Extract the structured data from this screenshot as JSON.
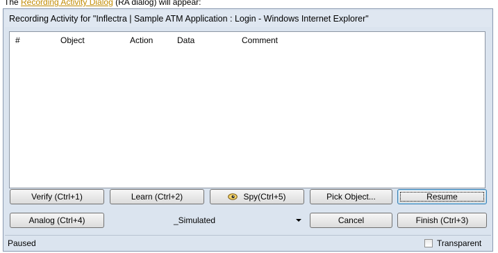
{
  "doc_text": {
    "prefix": "The ",
    "link": "Recording Activity Dialog",
    "suffix": " (RA dialog) will appear:"
  },
  "dialog": {
    "title": "Recording Activity for \"Inflectra | Sample ATM Application : Login - Windows Internet Explorer\""
  },
  "list": {
    "columns": [
      "#",
      "Object",
      "Action",
      "Data",
      "Comment"
    ]
  },
  "buttons": {
    "verify": "Verify (Ctrl+1)",
    "learn": "Learn (Ctrl+2)",
    "spy": "Spy(Ctrl+5)",
    "pick_object": "Pick Object...",
    "resume": "Resume",
    "analog": "Analog (Ctrl+4)",
    "cancel": "Cancel",
    "finish": "Finish (Ctrl+3)"
  },
  "play_mode": {
    "selected": "_Simulated"
  },
  "status": {
    "text": "Paused",
    "transparent_label": "Transparent",
    "transparent_checked": false
  },
  "icons": {
    "spy": "spy-eye-icon",
    "dropdown": "chevron-down-icon"
  }
}
